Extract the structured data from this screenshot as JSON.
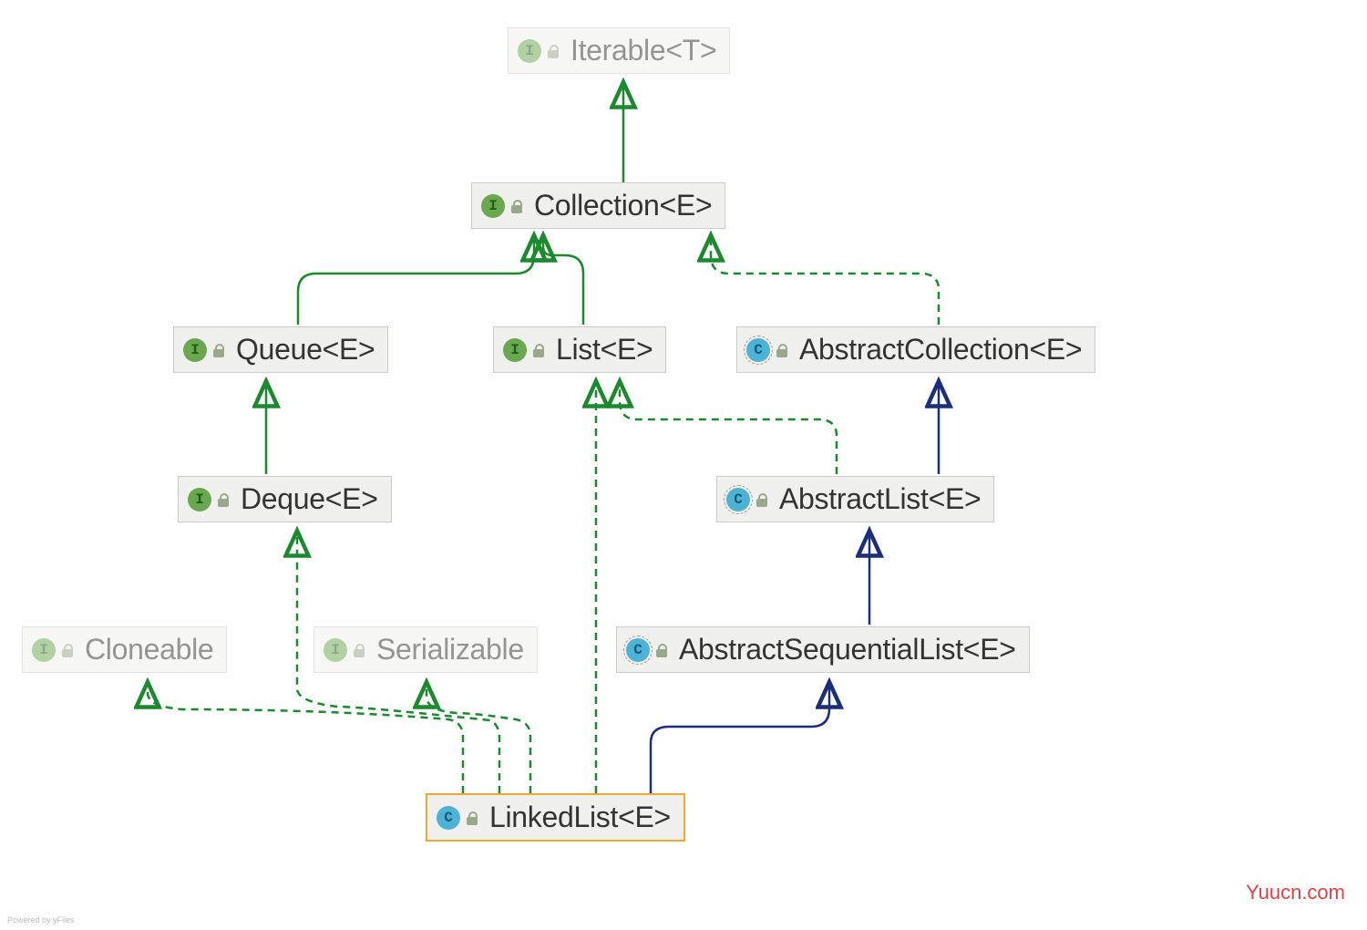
{
  "colors": {
    "green": "#1b8a2e",
    "blue": "#1b2e7c",
    "nodeBg": "#f0f0ef",
    "nodeBorder": "#cccccc",
    "highlight": "#f0a92e"
  },
  "nodes": {
    "iterable": {
      "kind": "interface",
      "label": "Iterable<T>",
      "faded": true,
      "highlight": false
    },
    "collection": {
      "kind": "interface",
      "label": "Collection<E>",
      "faded": false,
      "highlight": false
    },
    "queue": {
      "kind": "interface",
      "label": "Queue<E>",
      "faded": false,
      "highlight": false
    },
    "list": {
      "kind": "interface",
      "label": "List<E>",
      "faded": false,
      "highlight": false
    },
    "abstractColl": {
      "kind": "abstract-class",
      "label": "AbstractCollection<E>",
      "faded": false,
      "highlight": false
    },
    "deque": {
      "kind": "interface",
      "label": "Deque<E>",
      "faded": false,
      "highlight": false
    },
    "abstractList": {
      "kind": "abstract-class",
      "label": "AbstractList<E>",
      "faded": false,
      "highlight": false
    },
    "cloneable": {
      "kind": "interface",
      "label": "Cloneable",
      "faded": true,
      "highlight": false
    },
    "serializable": {
      "kind": "interface",
      "label": "Serializable",
      "faded": true,
      "highlight": false
    },
    "abstractSeq": {
      "kind": "abstract-class",
      "label": "AbstractSequentialList<E>",
      "faded": false,
      "highlight": false
    },
    "linkedList": {
      "kind": "class",
      "label": "LinkedList<E>",
      "faded": false,
      "highlight": true
    }
  },
  "edges": [
    {
      "from": "collection",
      "to": "iterable",
      "style": "solid",
      "color": "green"
    },
    {
      "from": "queue",
      "to": "collection",
      "style": "solid",
      "color": "green"
    },
    {
      "from": "list",
      "to": "collection",
      "style": "solid",
      "color": "green"
    },
    {
      "from": "abstractColl",
      "to": "collection",
      "style": "dashed",
      "color": "green"
    },
    {
      "from": "deque",
      "to": "queue",
      "style": "solid",
      "color": "green"
    },
    {
      "from": "abstractList",
      "to": "abstractColl",
      "style": "solid",
      "color": "blue"
    },
    {
      "from": "abstractList",
      "to": "list",
      "style": "dashed",
      "color": "green"
    },
    {
      "from": "abstractSeq",
      "to": "abstractList",
      "style": "solid",
      "color": "blue"
    },
    {
      "from": "linkedList",
      "to": "abstractSeq",
      "style": "solid",
      "color": "blue"
    },
    {
      "from": "linkedList",
      "to": "deque",
      "style": "dashed",
      "color": "green"
    },
    {
      "from": "linkedList",
      "to": "list",
      "style": "dashed",
      "color": "green"
    },
    {
      "from": "linkedList",
      "to": "cloneable",
      "style": "dashed",
      "color": "green"
    },
    {
      "from": "linkedList",
      "to": "serializable",
      "style": "dashed",
      "color": "green"
    }
  ],
  "watermarks": {
    "bottomLeft": "Powered by yFiles",
    "bottomRight": "Yuucn.com"
  }
}
